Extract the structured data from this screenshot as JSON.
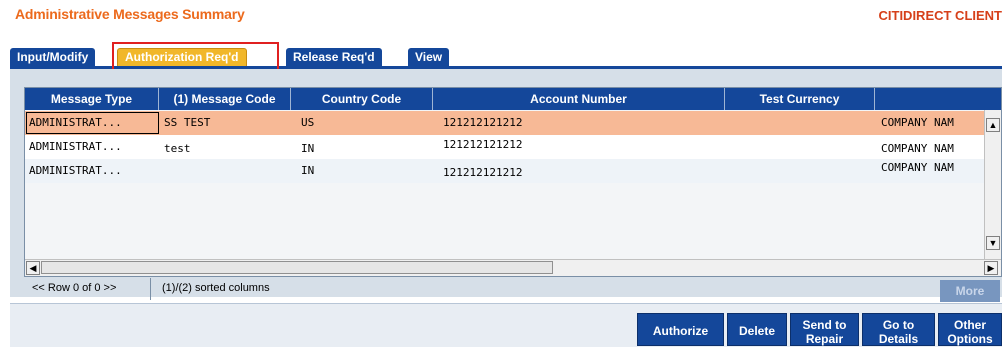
{
  "header": {
    "title": "Administrative Messages Summary",
    "client": "CITIDIRECT CLIENT"
  },
  "tabs": [
    {
      "label": "Input/Modify",
      "active": false
    },
    {
      "label": "Authorization Req'd",
      "active": true
    },
    {
      "label": "Release Req'd",
      "active": false
    },
    {
      "label": "View",
      "active": false
    }
  ],
  "grid": {
    "columns": [
      "Message Type",
      "(1) Message Code",
      "Country Code",
      "Account Number",
      "Test Currency",
      ""
    ],
    "rows": [
      {
        "message_type": "ADMINISTRAT...",
        "message_code": "SS TEST",
        "country_code": "US",
        "account_number": "121212121212",
        "test_currency": "",
        "extra": "COMPANY NAM"
      },
      {
        "message_type": "ADMINISTRAT...",
        "message_code": "test",
        "country_code": "IN",
        "account_number": "121212121212",
        "test_currency": "",
        "extra": "COMPANY NAM"
      },
      {
        "message_type": "ADMINISTRAT...",
        "message_code": "",
        "country_code": "IN",
        "account_number": "121212121212",
        "test_currency": "",
        "extra": "COMPANY NAM"
      }
    ]
  },
  "footer": {
    "row_nav": "<< Row 0 of 0 >>",
    "sorted": "(1)/(2) sorted columns",
    "more": "More"
  },
  "actions": {
    "authorize": "Authorize",
    "delete": "Delete",
    "send_to_repair_1": "Send to",
    "send_to_repair_2": "Repair",
    "go_to_details_1": "Go to",
    "go_to_details_2": "Details",
    "other_options_1": "Other",
    "other_options_2": "Options"
  },
  "colors": {
    "brand_blue": "#14479a",
    "title_orange": "#ec6a1d",
    "selected_row": "#f7b996",
    "active_tab": "#f1b72a"
  }
}
